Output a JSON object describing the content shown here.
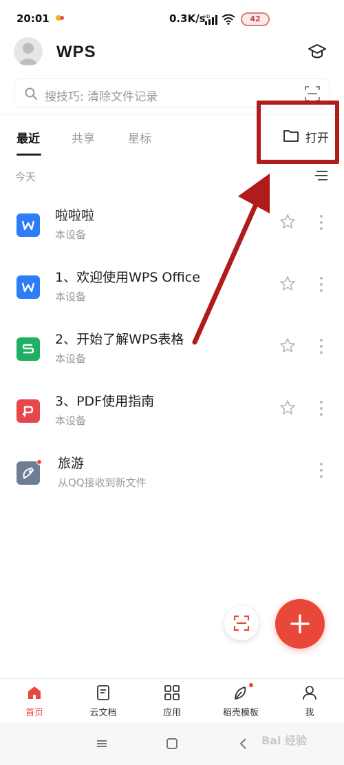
{
  "status_bar": {
    "time": "20:01",
    "network_speed": "0.3K/s",
    "battery": "42"
  },
  "header": {
    "logo": "WPS",
    "hat_icon": "graduation-cap-icon"
  },
  "search": {
    "placeholder": "搜技巧: 清除文件记录"
  },
  "tabs": {
    "items": [
      {
        "label": "最近",
        "active": true
      },
      {
        "label": "共享",
        "active": false
      },
      {
        "label": "星标",
        "active": false
      }
    ],
    "open_label": "打开"
  },
  "section": {
    "label": "今天"
  },
  "files": [
    {
      "name": "啦啦啦",
      "source": "本设备",
      "type": "word",
      "color": "#2e7cf6",
      "starrable": true
    },
    {
      "name": "1、欢迎使用WPS Office",
      "source": "本设备",
      "type": "word",
      "color": "#2e7cf6",
      "starrable": true
    },
    {
      "name": "2、开始了解WPS表格",
      "source": "本设备",
      "type": "sheet",
      "color": "#1fb061",
      "starrable": true
    },
    {
      "name": "3、PDF使用指南",
      "source": "本设备",
      "type": "pdf",
      "color": "#e5474b",
      "starrable": true
    },
    {
      "name": "旅游",
      "source": "从QQ接收到新文件",
      "type": "qq",
      "color": "#6f7d95",
      "starrable": false
    }
  ],
  "bottom_nav": [
    {
      "label": "首页",
      "icon": "home-icon",
      "active": true
    },
    {
      "label": "云文档",
      "icon": "cloud-doc-icon",
      "active": false
    },
    {
      "label": "应用",
      "icon": "apps-grid-icon",
      "active": false
    },
    {
      "label": "稻壳模板",
      "icon": "leaf-template-icon",
      "active": false
    },
    {
      "label": "我",
      "icon": "person-icon",
      "active": false
    }
  ],
  "watermark": "Bai 经验",
  "colors": {
    "accent": "#e8473a",
    "annotation": "#b01b1b"
  }
}
